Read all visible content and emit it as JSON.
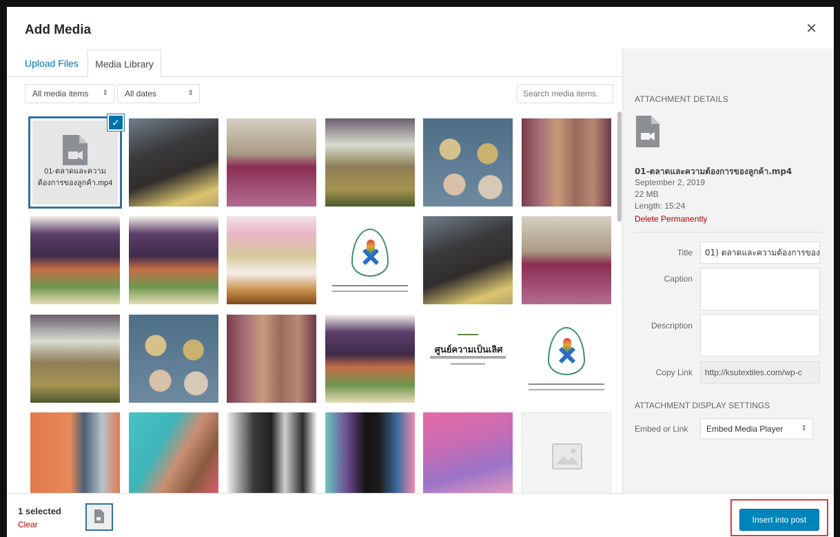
{
  "modal": {
    "title": "Add Media",
    "close_icon": "close-icon"
  },
  "tabs": [
    {
      "label": "Upload Files",
      "active": false
    },
    {
      "label": "Media Library",
      "active": true
    }
  ],
  "filters": {
    "type_filter": "All media items",
    "date_filter": "All dates",
    "search_placeholder": "Search media items."
  },
  "grid": {
    "selected_item": {
      "filename": "01-ตลาดและความต้องการของลูกค้า.mp4",
      "icon": "video-file-icon",
      "checked_icon": "checkmark-icon"
    },
    "thai_image_text": "ศูนย์ความเป็นเลิศ"
  },
  "details": {
    "heading": "ATTACHMENT DETAILS",
    "filename": "01-ตลาดและความต้องการของลูกค้า.mp4",
    "date": "September 2, 2019",
    "size": "22 MB",
    "length": "Length: 15:24",
    "delete_label": "Delete Permanently",
    "title_label": "Title",
    "title_value": "01) ตลาดและความต้องการของ",
    "caption_label": "Caption",
    "caption_value": "",
    "description_label": "Description",
    "description_value": "",
    "copy_link_label": "Copy Link",
    "copy_link_value": "http://ksutextiles.com/wp-c"
  },
  "display_settings": {
    "heading": "ATTACHMENT DISPLAY SETTINGS",
    "embed_label": "Embed or Link",
    "embed_value": "Embed Media Player"
  },
  "footer": {
    "selected_count": "1 selected",
    "clear_label": "Clear",
    "insert_label": "Insert into post"
  },
  "colors": {
    "accent": "#0085ba",
    "selection_border": "#2f6fa4",
    "delete": "#aa0000",
    "highlight": "#d93a3a"
  }
}
